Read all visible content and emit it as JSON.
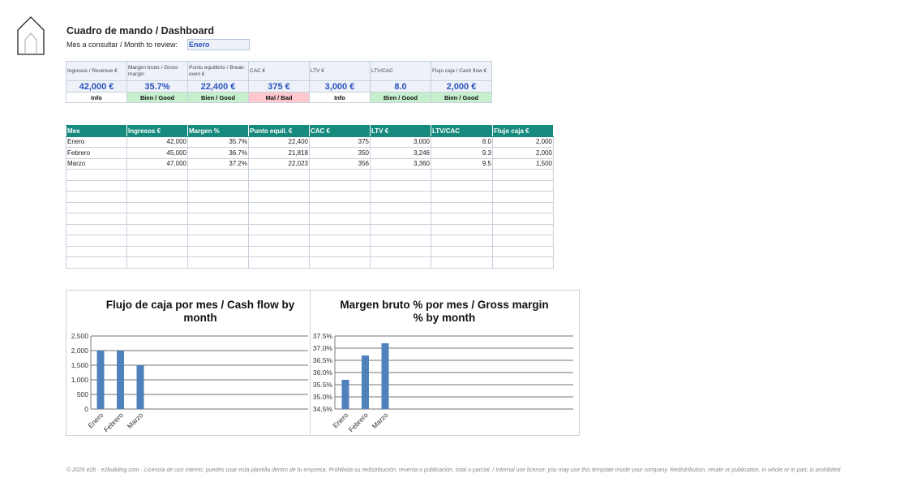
{
  "header": {
    "title": "Cuadro de mando / Dashboard",
    "month_label": "Mes a consultar / Month to review:",
    "month_value": "Enero"
  },
  "kpis": [
    {
      "label": "Ingresos / Revenue €",
      "value": "42,000 €",
      "status": "Info",
      "status_class": "info"
    },
    {
      "label": "Margen bruto / Gross margin",
      "value": "35.7%",
      "status": "Bien / Good",
      "status_class": "good"
    },
    {
      "label": "Punto equilibrio / Break-even €",
      "value": "22,400 €",
      "status": "Bien / Good",
      "status_class": "good"
    },
    {
      "label": "CAC €",
      "value": "375 €",
      "status": "Mal / Bad",
      "status_class": "bad"
    },
    {
      "label": "LTV €",
      "value": "3,000 €",
      "status": "Info",
      "status_class": "info"
    },
    {
      "label": "LTV/CAC",
      "value": "8.0",
      "status": "Bien / Good",
      "status_class": "good"
    },
    {
      "label": "Flujo caja / Cash flow €",
      "value": "2,000 €",
      "status": "Bien / Good",
      "status_class": "good"
    }
  ],
  "table": {
    "columns": [
      "Mes",
      "Ingresos €",
      "Margen %",
      "Punto equil. €",
      "CAC €",
      "LTV €",
      "LTV/CAC",
      "Flujo caja €"
    ],
    "rows": [
      [
        "Enero",
        "42,000",
        "35.7%",
        "22,400",
        "375",
        "3,000",
        "8.0",
        "2,000"
      ],
      [
        "Febrero",
        "45,000",
        "36.7%",
        "21,818",
        "350",
        "3,246",
        "9.3",
        "2,000"
      ],
      [
        "Marzo",
        "47,000",
        "37.2%",
        "22,023",
        "356",
        "3,360",
        "9.5",
        "1,500"
      ]
    ],
    "empty_rows": 9
  },
  "chart_data": [
    {
      "type": "bar",
      "title": "Flujo de caja por mes / Cash flow by month",
      "categories": [
        "Enero",
        "Febrero",
        "Marzo"
      ],
      "values": [
        2000,
        2000,
        1500
      ],
      "ylim": [
        0,
        2500
      ],
      "yticks": [
        0,
        500,
        1000,
        1500,
        2000,
        2500
      ],
      "ytick_labels": [
        "0",
        "500",
        "1,000",
        "1,500",
        "2,000",
        "2,500"
      ],
      "xlabel": "",
      "ylabel": "",
      "grid": true,
      "color": "#4f81bd"
    },
    {
      "type": "bar",
      "title": "Margen bruto % por mes / Gross margin % by month",
      "categories": [
        "Enero",
        "Febrero",
        "Marzo"
      ],
      "values": [
        35.7,
        36.7,
        37.2
      ],
      "ylim": [
        34.5,
        37.5
      ],
      "yticks": [
        34.5,
        35.0,
        35.5,
        36.0,
        36.5,
        37.0,
        37.5
      ],
      "ytick_labels": [
        "34.5%",
        "35.0%",
        "35.5%",
        "36.0%",
        "36.5%",
        "37.0%",
        "37.5%"
      ],
      "xlabel": "",
      "ylabel": "",
      "grid": true,
      "color": "#4f81bd"
    }
  ],
  "footer": "© 2026 e2b · e2building.com · Licencia de uso interno: puedes usar esta plantilla dentro de tu empresa. Prohibida su redistribución, reventa o publicación, total o parcial. / Internal use license: you may use this template inside your company. Redistribution, resale or publication, in whole or in part, is prohibited."
}
